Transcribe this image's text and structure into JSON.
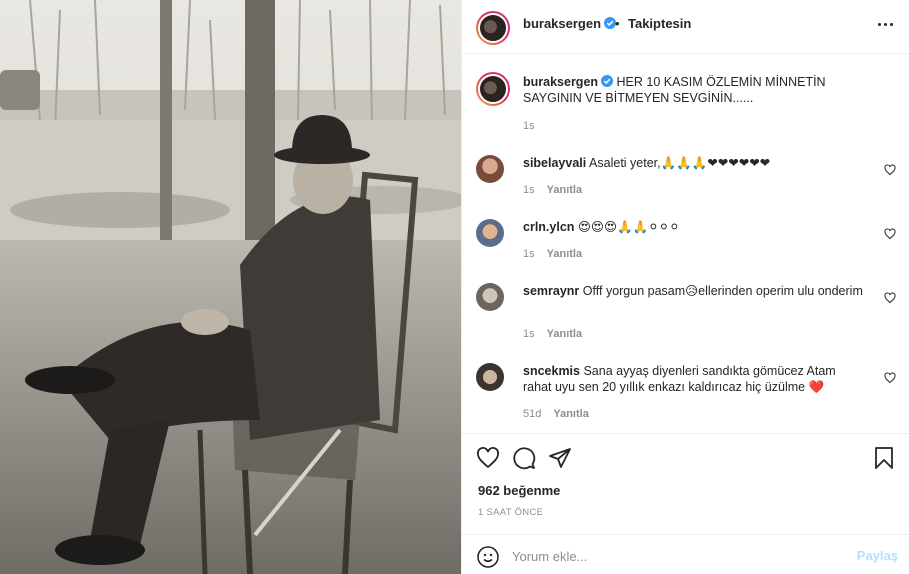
{
  "post": {
    "username": "buraksergen",
    "verified": true,
    "follow_separator": "•",
    "follow_status": "Takiptesin",
    "more_icon": "more-horizontal-icon"
  },
  "caption": {
    "username": "buraksergen",
    "text": "HER 10 KASIM ÖZLEMİN MİNNETİN SAYGININ VE BİTMEYEN SEVGİNİN......",
    "time": "1s"
  },
  "comments": [
    {
      "username": "sibelayvali",
      "text": "Asaleti yeter,🙏🙏🙏❤❤❤❤❤❤",
      "time": "1s",
      "reply_label": "Yanıtla"
    },
    {
      "username": "crln.ylcn",
      "text": "😍😍😍🙏🙏⚪⚪⚪",
      "time": "1s",
      "reply_label": "Yanıtla"
    },
    {
      "username": "semraynr",
      "text": "Offf yorgun pasam😥ellerinden operim ulu onderim",
      "time": "1s",
      "reply_label": "Yanıtla"
    },
    {
      "username": "sncekmis",
      "text": "Sana ayyaş diyenleri sandıkta gömücez Atam rahat uyu sen 20 yıllık enkazı kaldırıcaz hiç üzülme ❤️",
      "time": "51d",
      "reply_label": "Yanıtla"
    }
  ],
  "actions": {
    "likes": "962 beğenme",
    "timestamp": "1 SAAT ÖNCE",
    "icons": [
      "heart-icon",
      "comment-icon",
      "share-icon",
      "bookmark-icon"
    ]
  },
  "add_comment": {
    "placeholder": "Yorum ekle...",
    "submit_label": "Paylaş"
  },
  "colors": {
    "verified_blue": "#3897f0",
    "share_disabled": "#b2dffc",
    "secondary_text": "#8e8e8e"
  }
}
